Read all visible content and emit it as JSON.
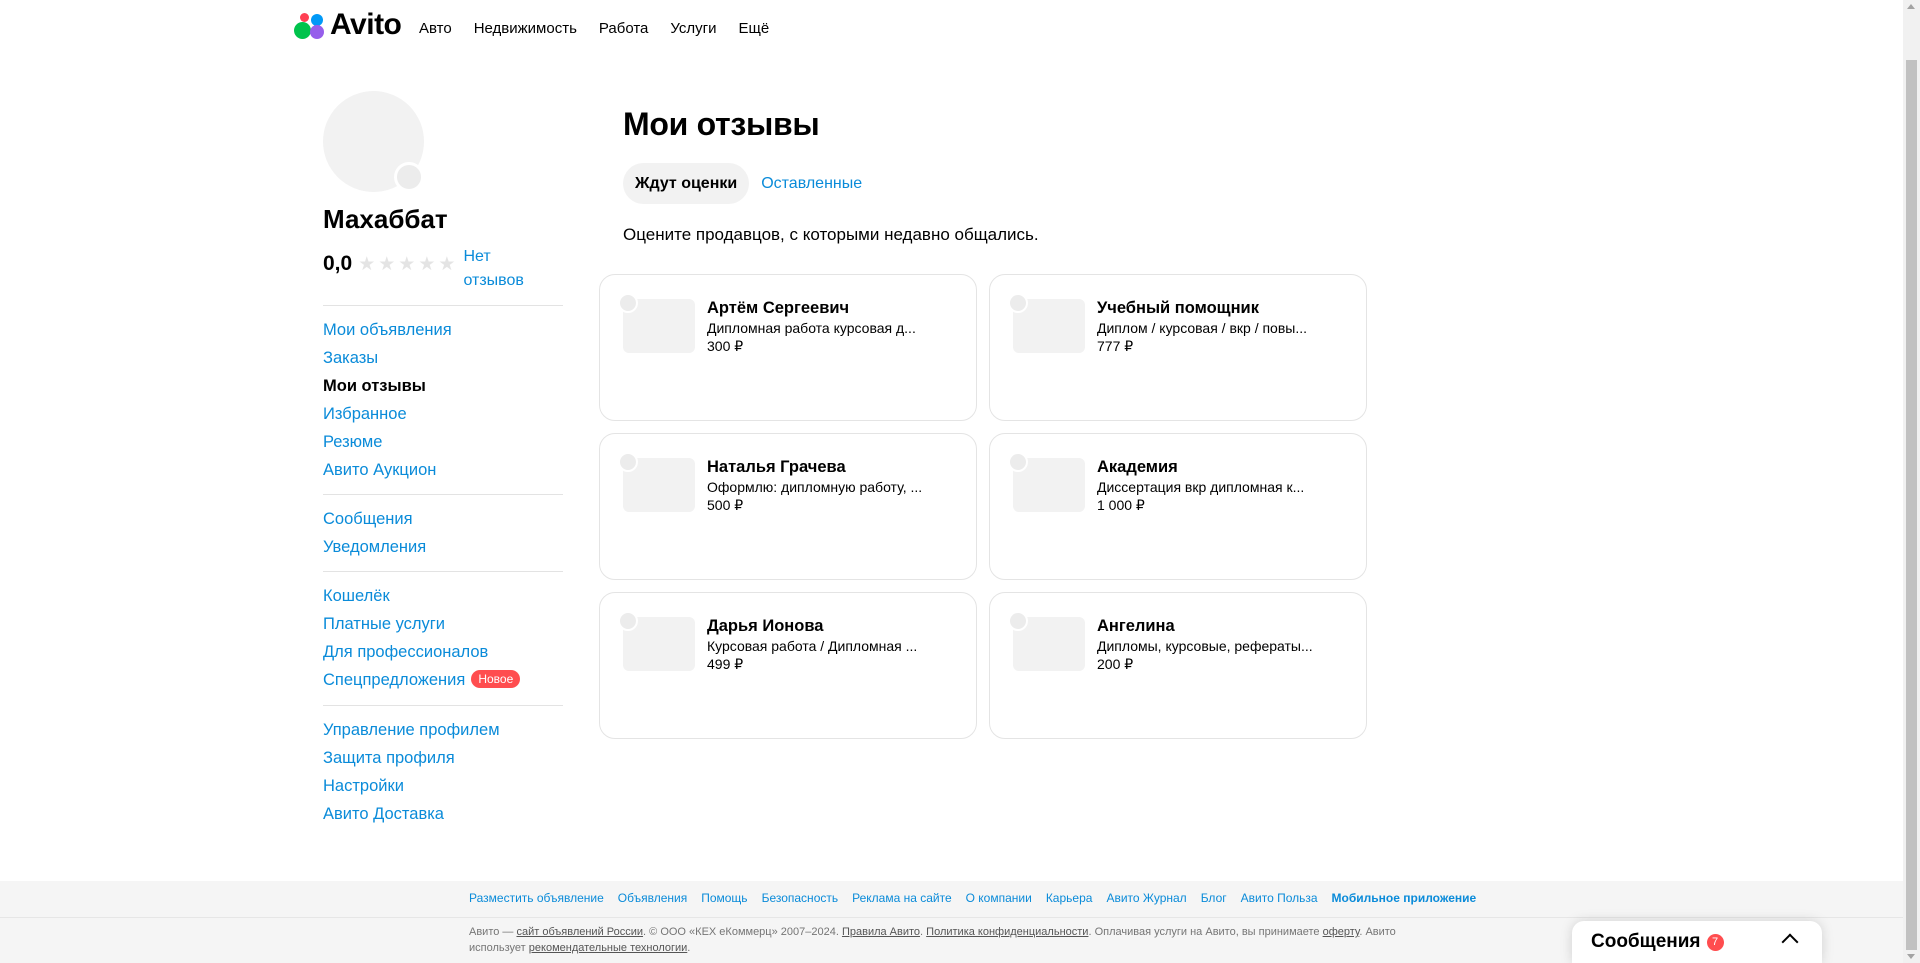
{
  "header": {
    "logo_text": "Avito",
    "nav": [
      "Авто",
      "Недвижимость",
      "Работа",
      "Услуги",
      "Ещё"
    ]
  },
  "profile": {
    "name": "Махаббат",
    "rating": "0,0",
    "stars_filled": 0,
    "stars_total": 5,
    "reviews_link": "Нет отзывов"
  },
  "sidebar": {
    "group1": [
      "Мои объявления",
      "Заказы",
      "Мои отзывы",
      "Избранное",
      "Резюме",
      "Авито Аукцион"
    ],
    "group2": [
      "Сообщения",
      "Уведомления"
    ],
    "group3": [
      "Кошелёк",
      "Платные услуги",
      "Для профессионалов",
      "Спецпредложения"
    ],
    "new_badge": "Новое",
    "group4": [
      "Управление профилем",
      "Защита профиля",
      "Настройки",
      "Авито Доставка"
    ],
    "active_item": "Мои отзывы"
  },
  "main": {
    "title": "Мои отзывы",
    "tabs": [
      "Ждут оценки",
      "Оставленные"
    ],
    "active_tab": "Ждут оценки",
    "hint": "Оцените продавцов, с которыми недавно общались.",
    "cards": [
      {
        "name": "Артём Сергеевич",
        "desc": "Дипломная работа курсовая д...",
        "price": "300 ₽"
      },
      {
        "name": "Учебный помощник",
        "desc": "Диплом / курсовая / вкр / повы...",
        "price": "777 ₽"
      },
      {
        "name": "Наталья Грачева",
        "desc": "Оформлю: дипломную работу, ...",
        "price": "500 ₽"
      },
      {
        "name": "Академия",
        "desc": "Диссертация вкр дипломная к...",
        "price": "1 000 ₽"
      },
      {
        "name": "Дарья Ионова",
        "desc": "Курсовая работа / Дипломная ...",
        "price": "499 ₽"
      },
      {
        "name": "Ангелина",
        "desc": "Дипломы, курсовые, рефераты...",
        "price": "200 ₽"
      }
    ]
  },
  "footer": {
    "links": [
      "Разместить объявление",
      "Объявления",
      "Помощь",
      "Безопасность",
      "Реклама на сайте",
      "О компании",
      "Карьера",
      "Авито Журнал",
      "Блог",
      "Авито Польза",
      "Мобильное приложение"
    ],
    "legal": {
      "p1": "Авито — ",
      "l1": "сайт объявлений России",
      "p2": ". © ООО «КЕХ еКоммерц» 2007–2024. ",
      "l2": "Правила Авито",
      "p3": ". ",
      "l3": "Политика конфиденциальности",
      "p4": ". Оплачивая услуги на Авито, вы принимаете ",
      "l4": "оферту",
      "p5": ". Авито использует ",
      "l5": "рекомендательные технологии",
      "p6": "."
    }
  },
  "messenger": {
    "label": "Сообщения",
    "count": "7"
  }
}
